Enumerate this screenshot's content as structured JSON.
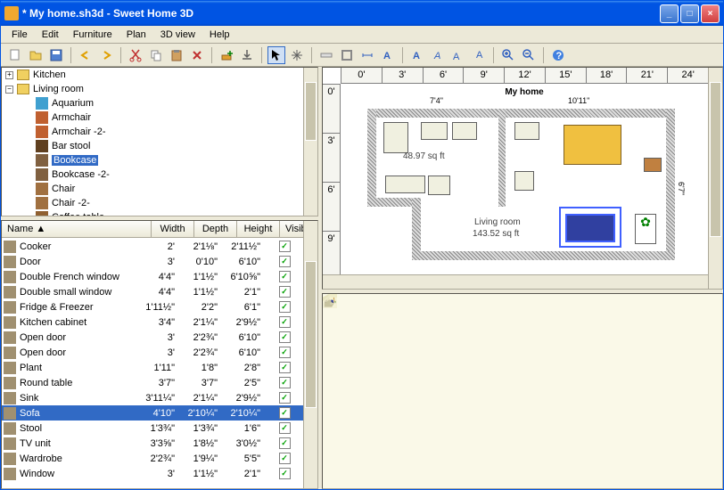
{
  "title": "* My home.sh3d - Sweet Home 3D",
  "menus": [
    "File",
    "Edit",
    "Furniture",
    "Plan",
    "3D view",
    "Help"
  ],
  "tree": {
    "root1": "Kitchen",
    "root2": "Living room",
    "items": [
      "Aquarium",
      "Armchair",
      "Armchair -2-",
      "Bar stool",
      "Bookcase",
      "Bookcase -2-",
      "Chair",
      "Chair -2-",
      "Coffee table"
    ],
    "selected": 4
  },
  "table": {
    "headers": {
      "name": "Name ▲",
      "width": "Width",
      "depth": "Depth",
      "height": "Height",
      "visible": "Visible"
    },
    "rows": [
      {
        "n": "Cooker",
        "w": "2'",
        "d": "2'1⅛\"",
        "h": "2'11½\""
      },
      {
        "n": "Door",
        "w": "3'",
        "d": "0'10\"",
        "h": "6'10\""
      },
      {
        "n": "Double French window",
        "w": "4'4\"",
        "d": "1'1½\"",
        "h": "6'10⅝\""
      },
      {
        "n": "Double small window",
        "w": "4'4\"",
        "d": "1'1½\"",
        "h": "2'1\""
      },
      {
        "n": "Fridge & Freezer",
        "w": "1'11½\"",
        "d": "2'2\"",
        "h": "6'1\""
      },
      {
        "n": "Kitchen cabinet",
        "w": "3'4\"",
        "d": "2'1¼\"",
        "h": "2'9½\""
      },
      {
        "n": "Open door",
        "w": "3'",
        "d": "2'2¾\"",
        "h": "6'10\""
      },
      {
        "n": "Open door",
        "w": "3'",
        "d": "2'2¾\"",
        "h": "6'10\""
      },
      {
        "n": "Plant",
        "w": "1'11\"",
        "d": "1'8\"",
        "h": "2'8\""
      },
      {
        "n": "Round table",
        "w": "3'7\"",
        "d": "3'7\"",
        "h": "2'5\""
      },
      {
        "n": "Sink",
        "w": "3'11¼\"",
        "d": "2'1¼\"",
        "h": "2'9½\""
      },
      {
        "n": "Sofa",
        "w": "4'10\"",
        "d": "2'10¼\"",
        "h": "2'10¼\"",
        "sel": true
      },
      {
        "n": "Stool",
        "w": "1'3¾\"",
        "d": "1'3¾\"",
        "h": "1'6\""
      },
      {
        "n": "TV unit",
        "w": "3'3⅝\"",
        "d": "1'8½\"",
        "h": "3'0½\""
      },
      {
        "n": "Wardrobe",
        "w": "2'2¾\"",
        "d": "1'9¼\"",
        "h": "5'5\""
      },
      {
        "n": "Window",
        "w": "3'",
        "d": "1'1½\"",
        "h": "2'1\""
      }
    ]
  },
  "plan": {
    "title": "My home",
    "ruler_h": [
      "0'",
      "3'",
      "6'",
      "9'",
      "12'",
      "15'",
      "18'",
      "21'",
      "24'"
    ],
    "ruler_v": [
      "0'",
      "3'",
      "6'",
      "9'"
    ],
    "room1": "48.97 sq ft",
    "room2_name": "Living room",
    "room2_area": "143.52 sq ft",
    "dim1": "7'4\"",
    "dim2": "10'11\"",
    "dim3": "6'7\""
  }
}
